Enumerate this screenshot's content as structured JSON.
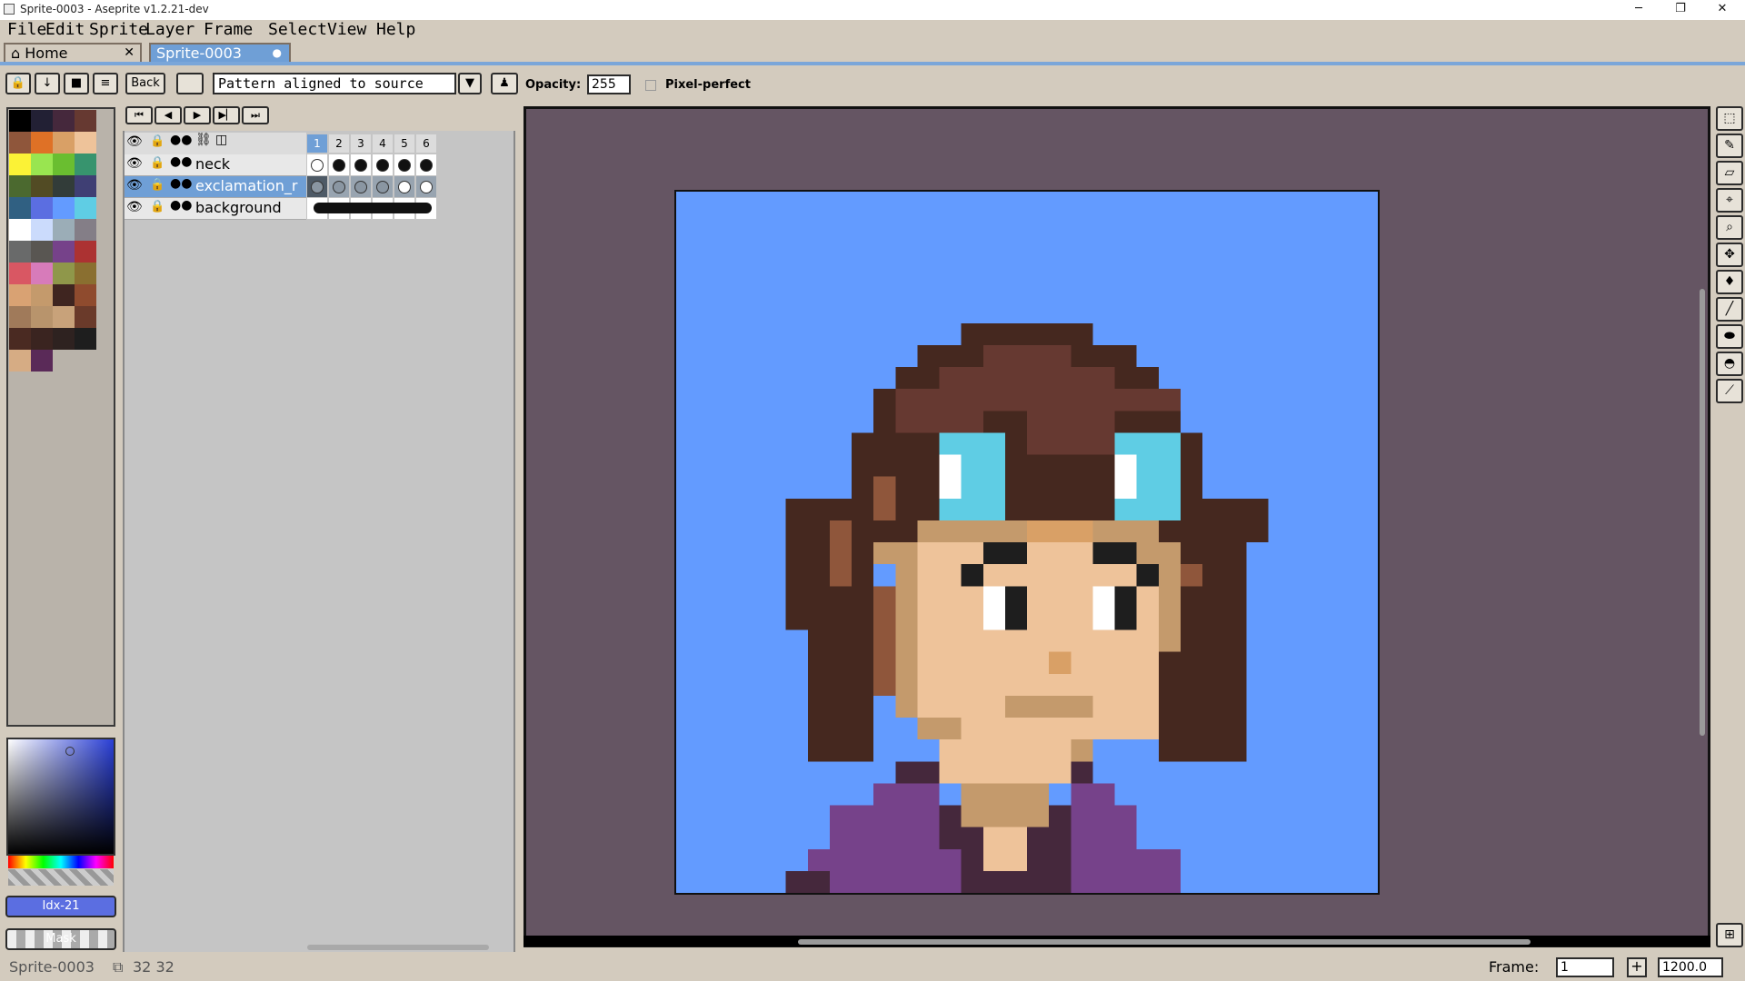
{
  "window": {
    "title": "Sprite-0003 - Aseprite v1.2.21-dev",
    "minimize": "─",
    "maximize": "❐",
    "close": "✕"
  },
  "menu": [
    "File",
    "Edit",
    "Sprite",
    "Layer",
    "Frame",
    "Select",
    "View",
    "Help"
  ],
  "tabs": {
    "home": "Home",
    "sprite": "Sprite-0003",
    "home_close": "✕",
    "sprite_dot": "●"
  },
  "toolbar": {
    "back_label": "Back",
    "pattern": "Pattern aligned to source",
    "opacity_label": "Opacity:",
    "opacity_value": "255",
    "pixel_perfect": "Pixel-perfect"
  },
  "palette": {
    "colors": [
      "#000000",
      "#222034",
      "#45283c",
      "#663931",
      "#8f563b",
      "#df7126",
      "#d9a066",
      "#eec39a",
      "#fbf236",
      "#99e550",
      "#6abe30",
      "#37946e",
      "#4b692f",
      "#524b24",
      "#323c39",
      "#3f3f74",
      "#306082",
      "#5b6ee1",
      "#639bff",
      "#5fcde4",
      "#ffffff",
      "#cbdbfc",
      "#9badb7",
      "#847e87",
      "#696a6a",
      "#595652",
      "#76428a",
      "#ac3232",
      "#d95763",
      "#d77bba",
      "#8f974a",
      "#8a6f30",
      "#d9a273",
      "#c49a6c",
      "#3f2520",
      "#8f4b2e",
      "#a07a5a",
      "#b8946c",
      "#c8a27a",
      "#6a3a2a",
      "#4a2a22",
      "#3a2420",
      "#2e2220",
      "#1e1e1e",
      "#d6ac84",
      "#5a2a58"
    ],
    "index_label": "Idx-21",
    "mask_label": "Mask"
  },
  "timeline": {
    "frames": [
      "1",
      "2",
      "3",
      "4",
      "5",
      "6"
    ],
    "layers": [
      {
        "name": "neck"
      },
      {
        "name": "exclamation_r"
      },
      {
        "name": "background"
      }
    ]
  },
  "status": {
    "sprite": "Sprite-0003",
    "size": "32 32",
    "frame_label": "Frame:",
    "frame_value": "1",
    "zoom": "1200.0"
  },
  "colors": {
    "canvas_bg": "#639bff",
    "editor_bg": "#655563",
    "accent": "#6f9fd6"
  }
}
